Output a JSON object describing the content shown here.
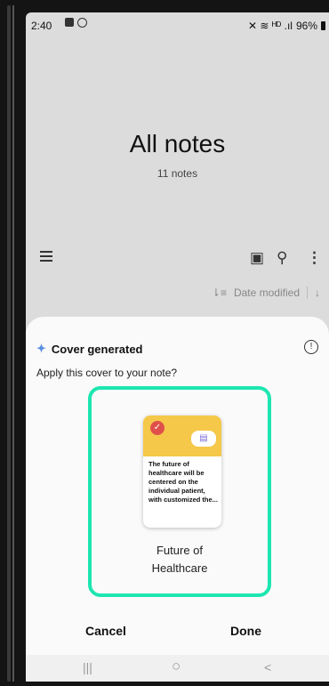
{
  "status": {
    "time": "2:40",
    "battery": "96%",
    "signal_glyphs": "✕ ≋ ᴴᴰ .ıl"
  },
  "header": {
    "title": "All notes",
    "count": "11 notes"
  },
  "toolbar": {
    "pdf_icon": "pdf-icon",
    "search_icon": "search-icon",
    "more_icon": "more-vert-icon"
  },
  "sort": {
    "label": "Date modified",
    "icon": "sort-icon",
    "direction_icon": "arrow-down-icon"
  },
  "sheet": {
    "title": "Cover generated",
    "description": "Apply this cover to your note?",
    "cover_text": "The future of healthcare will be centered on the individual patient, with customized the...",
    "cover_caption_line1": "Future of",
    "cover_caption_line2": "Healthcare",
    "cancel_label": "Cancel",
    "done_label": "Done"
  },
  "navbar": {
    "recents": "|||",
    "home": "○",
    "back": "<"
  },
  "colors": {
    "accent_frame": "#1de6b0",
    "cover_yellow": "#f5c84a",
    "check_red": "#e0504a"
  }
}
